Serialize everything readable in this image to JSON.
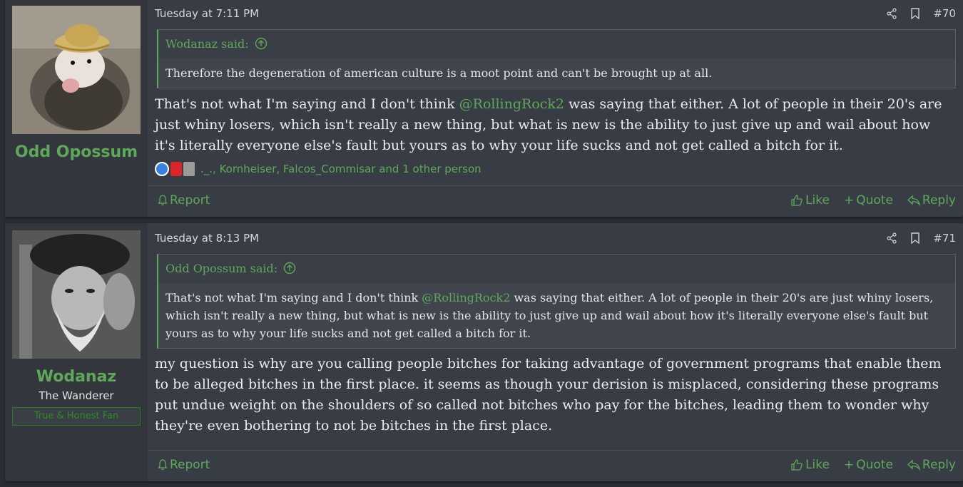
{
  "posts": [
    {
      "username": "Odd Opossum",
      "date": "Tuesday at 7:11 PM",
      "number": "#70",
      "quote": {
        "author": "Wodanaz said:",
        "text": "Therefore the degeneration of american culture is a moot point and can't be brought up at all."
      },
      "message": {
        "before": "That's not what I'm saying and I don't think ",
        "mention": "@RollingRock2",
        "after": " was saying that either. A lot of people in their 20's are just whiny losers, which isn't really a new thing, but what is new is the ability to just give up and wail about how it's literally everyone else's fault but yours as to why your life sucks and not get called a bitch for it."
      },
      "reactions_text": "._., Kornheiser, Falcos_Commisar and 1 other person",
      "actions": {
        "report": "Report",
        "like": "Like",
        "quote": "Quote",
        "reply": "Reply"
      }
    },
    {
      "username": "Wodanaz",
      "user_title": "The Wanderer",
      "user_banner": "True & Honest Fan",
      "date": "Tuesday at 8:13 PM",
      "number": "#71",
      "quote": {
        "author": "Odd Opossum said:",
        "before": "That's not what I'm saying and I don't think ",
        "mention": "@RollingRock2",
        "after": " was saying that either. A lot of people in their 20's are just whiny losers, which isn't really a new thing, but what is new is the ability to just give up and wail about how it's literally everyone else's fault but yours as to why your life sucks and not get called a bitch for it."
      },
      "message": "my question is why are you calling people bitches for taking advantage of government programs that enable them to be alleged bitches in the first place. it seems as though your derision is misplaced, considering these programs put undue weight on the shoulders of so called not bitches who pay for the bitches, leading them to wonder why they're even bothering to not be bitches in the first place.",
      "actions": {
        "report": "Report",
        "like": "Like",
        "quote": "Quote",
        "reply": "Reply"
      }
    }
  ],
  "colors": {
    "accent": "#5fa85b",
    "background": "#2a2d33",
    "post": "#383c44"
  }
}
